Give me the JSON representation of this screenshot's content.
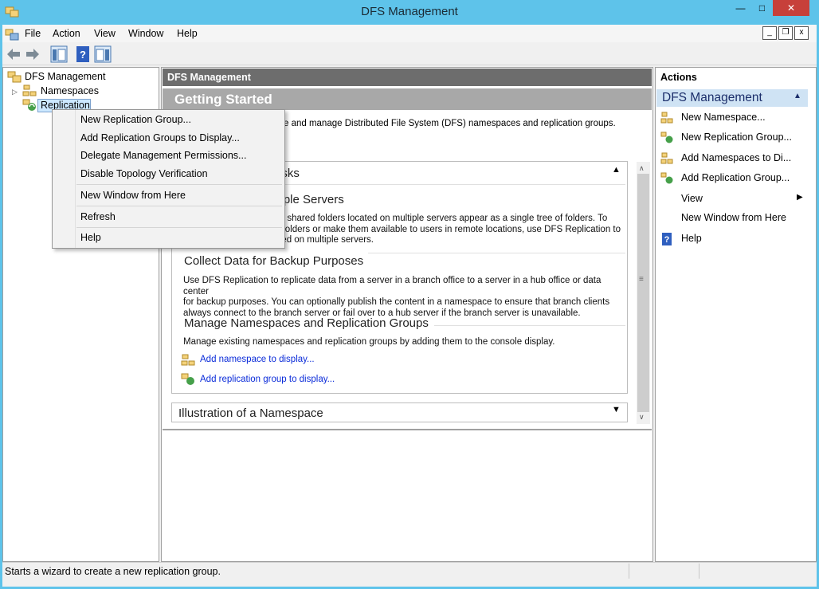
{
  "window": {
    "title": "DFS Management",
    "minimize": "—",
    "maximize": "□",
    "close": "✕"
  },
  "menubar": {
    "items": [
      "File",
      "Action",
      "View",
      "Window",
      "Help"
    ],
    "mdi_min": "_",
    "mdi_restore": "❐",
    "mdi_close": "x"
  },
  "tree": {
    "root": "DFS Management",
    "namespaces": "Namespaces",
    "replication": "Replication"
  },
  "center": {
    "header": "DFS Management",
    "getting_started": "Getting Started",
    "intro": "eate and manage Distributed File System (DFS) namespaces and replication groups.",
    "tasks_title": "asks",
    "section1_title": "ltiple Servers",
    "section1_text": [
      "ke shared folders located on multiple servers appear as a single tree of folders. To",
      "e folders or make them available to users in remote locations, use DFS Replication to",
      "ized on multiple servers."
    ],
    "section2_title": "Collect Data for Backup Purposes",
    "section2_text": [
      "Use DFS Replication to replicate data from a server in a branch office to a server in a hub office or data center",
      "for backup purposes. You can optionally publish the content in a namespace to ensure that branch clients",
      "always connect to the branch server or fail over to a hub server if the branch server is unavailable."
    ],
    "section3_title": "Manage Namespaces and Replication Groups",
    "section3_text": "Manage existing namespaces and replication groups by adding them to the console display.",
    "link_namespace": "Add namespace to display...",
    "link_replication": "Add replication group to display...",
    "illustration_title": "Illustration of a Namespace"
  },
  "actions": {
    "title": "Actions",
    "section": "DFS Management",
    "items": [
      "New Namespace...",
      "New Replication Group...",
      "Add Namespaces to Di...",
      "Add Replication Group...",
      "View",
      "New Window from Here",
      "Help"
    ]
  },
  "context_menu": {
    "items": [
      "New Replication Group...",
      "Add Replication Groups to Display...",
      "Delegate Management Permissions...",
      "Disable Topology Verification",
      "New Window from Here",
      "Refresh",
      "Help"
    ]
  },
  "statusbar": {
    "text": "Starts a wizard to create a new replication group."
  },
  "colors": {
    "titlebar": "#5ec3ea",
    "close": "#c7403a",
    "link": "#0a2bd9",
    "selection": "#cce8ff"
  }
}
